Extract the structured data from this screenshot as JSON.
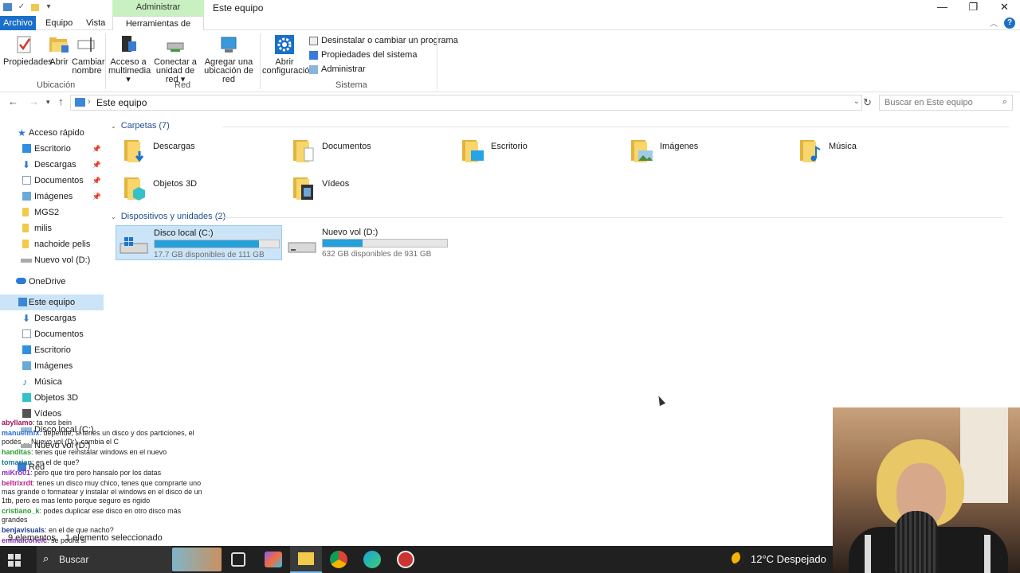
{
  "titlebar": {
    "context_tab": "Administrar",
    "title": "Este equipo",
    "controls": [
      "minimize-icon",
      "restore-icon",
      "close-icon"
    ]
  },
  "ribbon_tabs": {
    "archivo": "Archivo",
    "equipo": "Equipo",
    "vista": "Vista",
    "herramientas": "Herramientas de unidad"
  },
  "ribbon": {
    "ubicacion": {
      "label": "Ubicación",
      "propiedades": "Propiedades",
      "abrir": "Abrir",
      "cambiar1": "Cambiar",
      "cambiar2": "nombre"
    },
    "red": {
      "label": "Red",
      "multimedia1": "Acceso a",
      "multimedia2": "multimedia",
      "conectar1": "Conectar a",
      "conectar2": "unidad de red",
      "agregar1": "Agregar una",
      "agregar2": "ubicación de red"
    },
    "sistema": {
      "label": "Sistema",
      "abrir_conf1": "Abrir",
      "abrir_conf2": "configuración",
      "desinstalar": "Desinstalar o cambiar un programa",
      "propiedades_sistema": "Propiedades del sistema",
      "administrar": "Administrar"
    }
  },
  "address": {
    "path": "Este equipo",
    "search_placeholder": "Buscar en Este equipo"
  },
  "sidebar": {
    "acceso_rapido": "Acceso rápido",
    "quick": [
      "Escritorio",
      "Descargas",
      "Documentos",
      "Imágenes",
      "MGS2",
      "milis",
      "nachoide pelis",
      "Nuevo vol (D:)"
    ],
    "onedrive": "OneDrive",
    "este_equipo": "Este equipo",
    "equipo_items": [
      "Descargas",
      "Documentos",
      "Escritorio",
      "Imágenes",
      "Música",
      "Objetos 3D",
      "Vídeos",
      "Disco local (C:)",
      "Nuevo vol (D:)"
    ],
    "red": "Red"
  },
  "content": {
    "carpetas_header": "Carpetas (7)",
    "folders": [
      "Descargas",
      "Documentos",
      "Escritorio",
      "Imágenes",
      "Música",
      "Objetos 3D",
      "Vídeos"
    ],
    "dispositivos_header": "Dispositivos y unidades (2)",
    "drives": [
      {
        "name": "Disco local (C:)",
        "free": "17.7 GB disponibles de 111 GB",
        "used_fraction": 0.84
      },
      {
        "name": "Nuevo vol (D:)",
        "free": "632 GB disponibles de 931 GB",
        "used_fraction": 0.32
      }
    ]
  },
  "chat": [
    {
      "user": "abyllamo",
      "text": "ta nos bein",
      "color": "#a0135a"
    },
    {
      "user": "manuelmfx",
      "text": "depende, si tenés un disco y dos particiones, el podés ... Nuevo vol (D:), cambia el C",
      "color": "#2a6bd1"
    },
    {
      "user": "handitas",
      "text": "tenes que reinstalar windows en el nuevo",
      "color": "#2e9b36"
    },
    {
      "user": "tomarian",
      "text": "en el de que?",
      "color": "#1e7a8c"
    },
    {
      "user": "miKro01",
      "text": "pero que tiro pero hansalo por los datas",
      "color": "#8b2ab5"
    },
    {
      "user": "beltrixrdt",
      "text": "tenes un disco muy chico, tenes que comprarte uno mas grande o formatear y instalar el windows en el disco de un 1tb, pero es mas lento porque seguro es rigido",
      "color": "#b5208f"
    },
    {
      "user": "cristiano_k",
      "text": "podes duplicar ese disco en otro disco más grandes",
      "color": "#2e9b36"
    },
    {
      "user": "benjavisuals",
      "text": "en el de que nacho?",
      "color": "#1e3a8c"
    },
    {
      "user": "emmaiconelc",
      "text": "se podrá si",
      "color": "#8b2ab5"
    }
  ],
  "status": {
    "items": "9 elementos",
    "selected": "1 elemento seleccionado"
  },
  "taskbar": {
    "search": "Buscar",
    "weather": "12°C  Despejado"
  }
}
